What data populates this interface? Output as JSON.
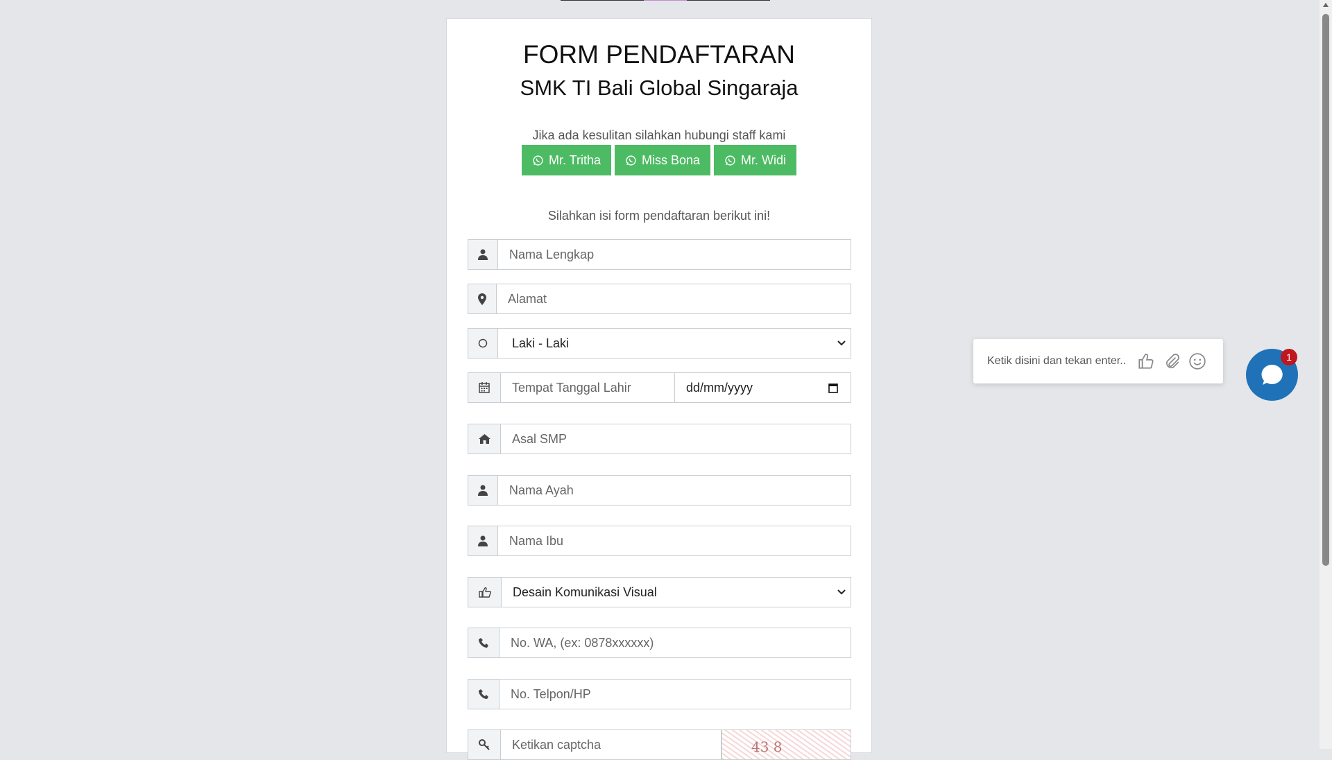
{
  "header": {
    "title": "FORM PENDAFTARAN",
    "subtitle": "SMK TI Bali Global Singaraja"
  },
  "contact": {
    "help_text": "Jika ada kesulitan silahkan hubungi staff kami",
    "buttons": [
      {
        "label": "Mr. Tritha",
        "icon": "whatsapp-icon"
      },
      {
        "label": "Miss Bona",
        "icon": "whatsapp-icon"
      },
      {
        "label": "Mr. Widi",
        "icon": "whatsapp-icon"
      }
    ],
    "button_color": "#4dbb63"
  },
  "form": {
    "instruction": "Silahkan isi form pendaftaran berikut ini!",
    "nama_lengkap": {
      "placeholder": "Nama Lengkap",
      "icon": "user-icon"
    },
    "alamat": {
      "placeholder": "Alamat",
      "icon": "map-marker-icon"
    },
    "jenis_kelamin": {
      "value": "Laki - Laki",
      "icon": "circle-icon"
    },
    "tempat_lahir": {
      "placeholder": "Tempat Tanggal Lahir",
      "icon": "calendar-icon"
    },
    "tanggal_lahir": {
      "placeholder": "dd/mm/yyyy",
      "icon": "calendar-picker-icon"
    },
    "asal_smp": {
      "placeholder": "Asal SMP",
      "icon": "home-icon"
    },
    "nama_ayah": {
      "placeholder": "Nama Ayah",
      "icon": "user-icon"
    },
    "nama_ibu": {
      "placeholder": "Nama Ibu",
      "icon": "user-icon"
    },
    "jurusan": {
      "value": "Desain Komunikasi Visual",
      "icon": "hand-pointer-icon"
    },
    "no_wa": {
      "placeholder": "No. WA, (ex: 0878xxxxxx)",
      "icon": "phone-icon"
    },
    "no_telpon": {
      "placeholder": "No. Telpon/HP",
      "icon": "phone-icon"
    },
    "captcha": {
      "placeholder": "Ketikan captcha",
      "icon": "key-icon",
      "image_text": "43 8"
    }
  },
  "chat": {
    "input_placeholder": "Ketik disini dan tekan enter..",
    "icons": [
      "thumbs-up-icon",
      "paperclip-icon",
      "smiley-icon"
    ],
    "badge_count": "1",
    "bubble_color": "#1f72b8"
  }
}
